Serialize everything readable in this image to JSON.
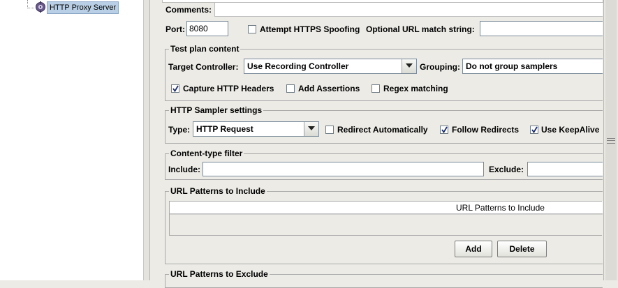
{
  "tree": {
    "items": [
      {
        "label": "HTTP Proxy Server",
        "icon": "proxy-server-icon"
      }
    ]
  },
  "settings": {
    "comments_label": "Comments:",
    "port_label": "Port:",
    "port_value": "8080",
    "https_spoofing_label": "Attempt HTTPS Spoofing",
    "https_spoofing_checked": false,
    "url_match_label": "Optional URL match string:",
    "url_match_value": ""
  },
  "test_plan_content": {
    "title": "Test plan content",
    "target_controller_label": "Target Controller:",
    "target_controller_value": "Use Recording Controller",
    "grouping_label": "Grouping:",
    "grouping_value": "Do not group samplers",
    "capture_headers_label": "Capture HTTP Headers",
    "capture_headers_checked": true,
    "add_assertions_label": "Add Assertions",
    "add_assertions_checked": false,
    "regex_matching_label": "Regex matching",
    "regex_matching_checked": false
  },
  "sampler_settings": {
    "title": "HTTP Sampler settings",
    "type_label": "Type:",
    "type_value": "HTTP Request",
    "redirect_auto_label": "Redirect Automatically",
    "redirect_auto_checked": false,
    "follow_redirects_label": "Follow Redirects",
    "follow_redirects_checked": true,
    "keepalive_label": "Use KeepAlive",
    "keepalive_checked": true
  },
  "content_type_filter": {
    "title": "Content-type filter",
    "include_label": "Include:",
    "include_value": "",
    "exclude_label": "Exclude:",
    "exclude_value": ""
  },
  "url_include": {
    "title": "URL Patterns to Include",
    "column_header": "URL Patterns to Include",
    "rows": [],
    "add_label": "Add",
    "delete_label": "Delete"
  },
  "url_exclude": {
    "title": "URL Patterns to Exclude"
  },
  "colors": {
    "window_bg": "#ecebe6",
    "selection_bg": "#b8cfe5"
  }
}
